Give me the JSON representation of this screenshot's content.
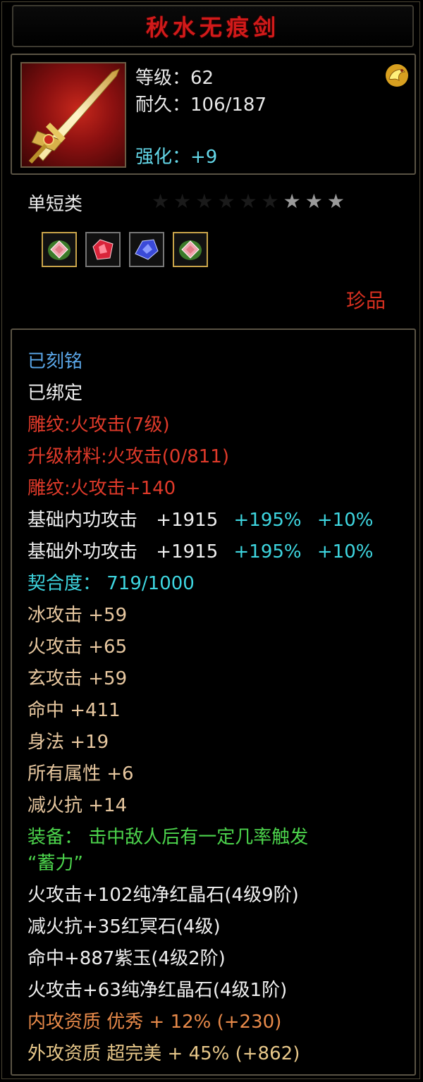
{
  "item": {
    "name": "秋水无痕剑",
    "level": "等级：62",
    "durability": "耐久：106/187",
    "enhance": "强化：+9",
    "category": "单短类",
    "rarity": "珍品",
    "stars_total": 9,
    "stars_lit": 3
  },
  "gems": [
    {
      "name": "pink-gem-icon",
      "color": "#e07a86"
    },
    {
      "name": "red-gem-icon",
      "color": "#d8243a"
    },
    {
      "name": "blue-gem-icon",
      "color": "#3a4ad8"
    },
    {
      "name": "pink-gem-icon",
      "color": "#e07a86"
    }
  ],
  "attributes": {
    "engraved": "已刻铭",
    "bound": "已绑定",
    "carving1": "雕纹:火攻击(7级)",
    "upgrade_material": "升级材料:火攻击(0/811)",
    "carving2": "雕纹:火攻击+140",
    "inner_attack": {
      "label": "基础内功攻击",
      "value": "+1915",
      "pct1": "+195%",
      "pct2": "+10%"
    },
    "outer_attack": {
      "label": "基础外功攻击",
      "value": "+1915",
      "pct1": "+195%",
      "pct2": "+10%"
    },
    "compatibility": "契合度： 719/1000",
    "ice_attack": "冰攻击  +59",
    "fire_attack": "火攻击  +65",
    "mystic_attack": "玄攻击  +59",
    "hit": "命中  +411",
    "agility": "身法  +19",
    "all_attributes": "所有属性  +6",
    "fire_resist_reduce": "减火抗  +14",
    "equip_effect_line1": "装备：  击中敌人后有一定几率触发",
    "equip_effect_line2": "“蓄力”",
    "socket1": "火攻击+102纯净红晶石(4级9阶)",
    "socket2": "减火抗+35红冥石(4级)",
    "socket3": "命中+887紫玉(4级2阶)",
    "socket4": "火攻击+63纯净红晶石(4级1阶)",
    "inner_quality": "内攻资质  优秀  + 12%  (+230)",
    "outer_quality": "外攻资质  超完美  + 45%  (+862)"
  }
}
